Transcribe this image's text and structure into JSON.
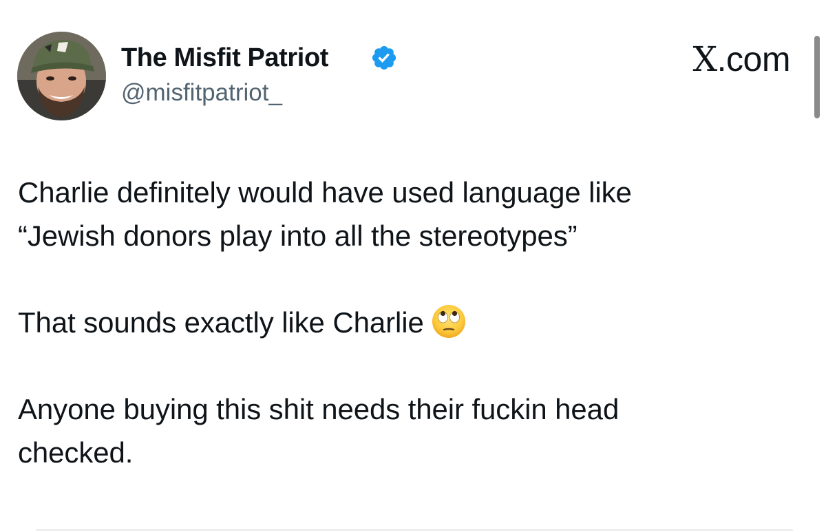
{
  "author": {
    "display_name": "The Misfit Patriot",
    "handle": "@misfitpatriot_",
    "verified": true,
    "avatar_icon": "profile-photo-icon"
  },
  "source_label": {
    "x_glyph": "X",
    "domain": ".com"
  },
  "tweet": {
    "paragraphs": [
      {
        "lines": [
          "Charlie definitely would have used language like",
          "“Jewish donors play into all the stereotypes”"
        ]
      },
      {
        "lines": [
          "That sounds exactly like Charlie"
        ],
        "trailing_emoji": "face-with-rolling-eyes-icon"
      },
      {
        "lines": [
          "Anyone buying this shit needs their fuckin head",
          "checked."
        ]
      }
    ]
  },
  "colors": {
    "text": "#0f1419",
    "secondary_text": "#536471",
    "verified_badge": "#1d9bf0",
    "background": "#ffffff"
  }
}
